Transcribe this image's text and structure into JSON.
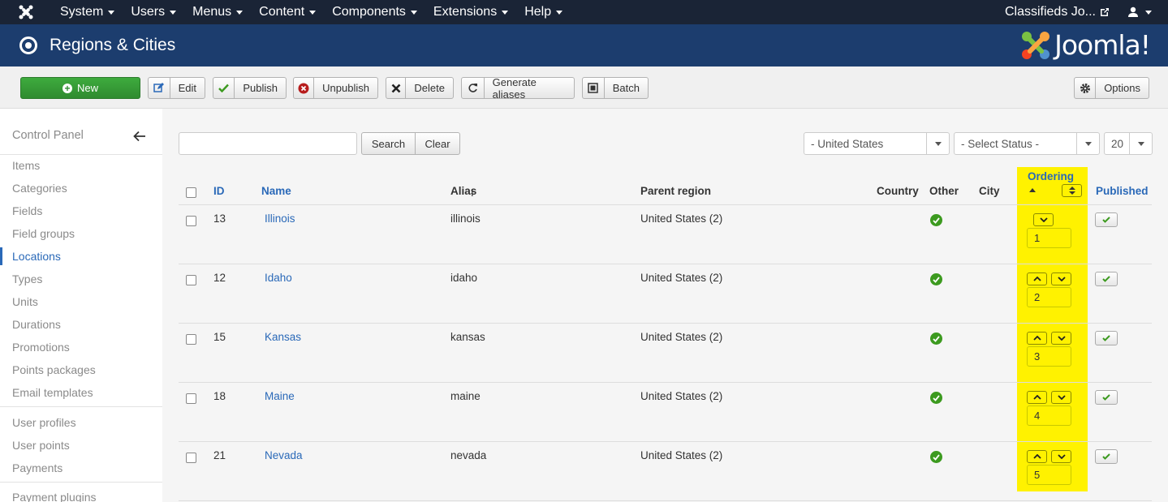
{
  "topnav": {
    "menu": [
      {
        "label": "System"
      },
      {
        "label": "Users"
      },
      {
        "label": "Menus"
      },
      {
        "label": "Content"
      },
      {
        "label": "Components"
      },
      {
        "label": "Extensions"
      },
      {
        "label": "Help"
      }
    ],
    "site_label": "Classifieds Jo..."
  },
  "header": {
    "title": "Regions & Cities",
    "brand": "Joomla!"
  },
  "toolbar": {
    "new_label": "New",
    "edit_label": "Edit",
    "publish_label": "Publish",
    "unpublish_label": "Unpublish",
    "delete_label": "Delete",
    "generate_label": "Generate aliases",
    "batch_label": "Batch",
    "options_label": "Options"
  },
  "sidebar": {
    "control_panel": "Control Panel",
    "items": [
      {
        "label": "Items"
      },
      {
        "label": "Categories"
      },
      {
        "label": "Fields"
      },
      {
        "label": "Field groups"
      },
      {
        "label": "Locations"
      },
      {
        "label": "Types"
      },
      {
        "label": "Units"
      },
      {
        "label": "Durations"
      },
      {
        "label": "Promotions"
      },
      {
        "label": "Points packages"
      },
      {
        "label": "Email templates"
      },
      {
        "label": "User profiles"
      },
      {
        "label": "User points"
      },
      {
        "label": "Payments"
      },
      {
        "label": "Payment plugins"
      }
    ],
    "active_item": "Locations"
  },
  "filters": {
    "search_value": "",
    "search_label": "Search",
    "clear_label": "Clear",
    "country": "- United States",
    "status": "- Select Status -",
    "limit": "20"
  },
  "table": {
    "headers": {
      "id": "ID",
      "name": "Name",
      "alias": "Alias",
      "parent": "Parent region",
      "country": "Country",
      "other": "Other",
      "city": "City",
      "ordering": "Ordering",
      "published": "Published"
    },
    "rows": [
      {
        "id": "13",
        "name": "Illinois",
        "alias": "illinois",
        "parent": "United States (2)",
        "order": "1"
      },
      {
        "id": "12",
        "name": "Idaho",
        "alias": "idaho",
        "parent": "United States (2)",
        "order": "2"
      },
      {
        "id": "15",
        "name": "Kansas",
        "alias": "kansas",
        "parent": "United States (2)",
        "order": "3"
      },
      {
        "id": "18",
        "name": "Maine",
        "alias": "maine",
        "parent": "United States (2)",
        "order": "4"
      },
      {
        "id": "21",
        "name": "Nevada",
        "alias": "nevada",
        "parent": "United States (2)",
        "order": "5"
      }
    ]
  },
  "colors": {
    "topnav_bg": "#1a2436",
    "header_bg": "#1c3d6e",
    "new_button": "#2f8b2f",
    "link": "#2a69b8",
    "highlight": "#fff200",
    "check_green": "#3c9a1f"
  }
}
